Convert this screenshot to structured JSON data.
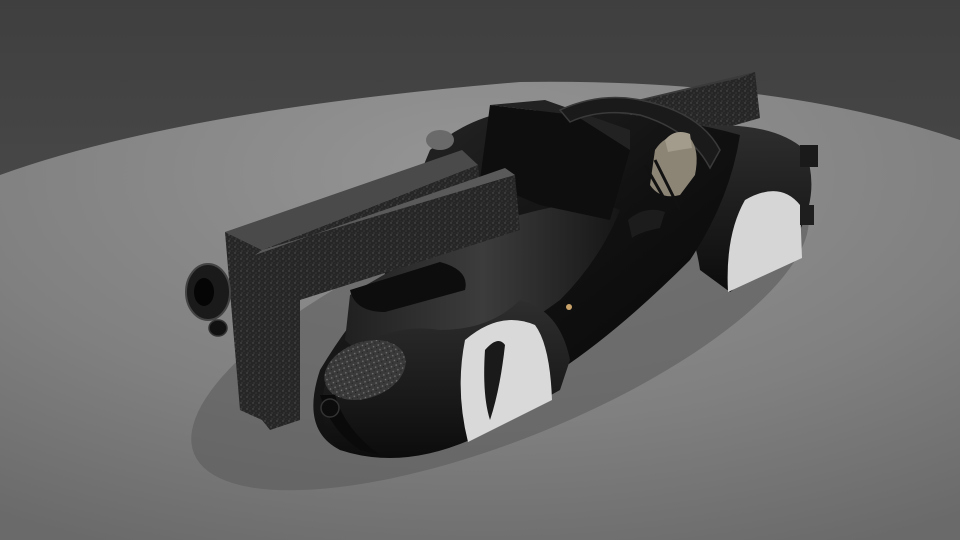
{
  "scene": {
    "subject": "car-render",
    "colors": {
      "backdrop": "#474747",
      "floor_near": "#7b7b7b",
      "floor_far": "#909090",
      "body": "#141414",
      "body_highlight": "#3a3a3a",
      "foam": "#2b2b2b",
      "wheel_wells": "#d9d9d9",
      "seat": "#8c8576",
      "indicator": "#c9a36a"
    }
  }
}
